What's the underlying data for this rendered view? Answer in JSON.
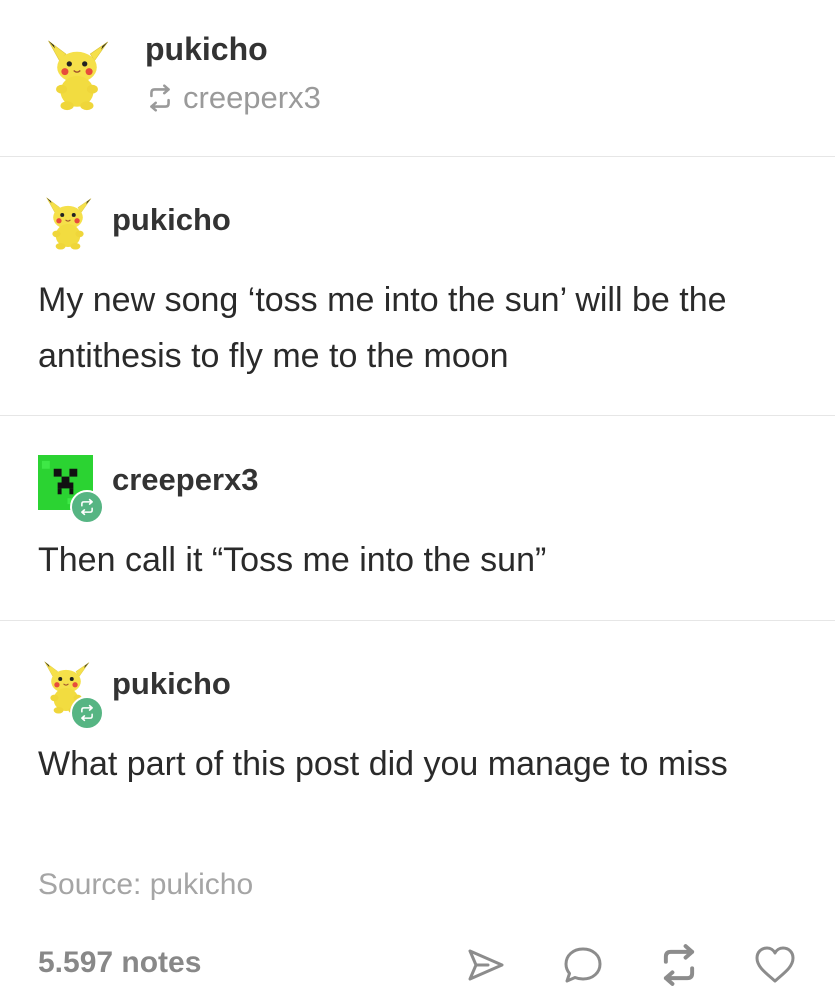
{
  "header": {
    "username": "pukicho",
    "reblogged_from": "creeperx3",
    "avatar_icon": "pikachu-plush-avatar",
    "reblog_icon": "reblog-icon"
  },
  "posts": [
    {
      "username": "pukicho",
      "avatar_icon": "pikachu-plush-avatar",
      "reblogged": false,
      "text": "My new song ‘toss me into the sun’ will be the antithesis to fly me to the moon"
    },
    {
      "username": "creeperx3",
      "avatar_icon": "creeper-face-avatar",
      "reblogged": true,
      "text": "Then call it “Toss me into the sun”"
    },
    {
      "username": "pukicho",
      "avatar_icon": "pikachu-plush-avatar",
      "reblogged": true,
      "text": "What part of this post did you manage to miss"
    }
  ],
  "footer": {
    "source_label": "Source: pukicho",
    "notes": "5.597 notes",
    "actions": [
      "share-icon",
      "reply-icon",
      "reblog-icon",
      "like-icon"
    ]
  },
  "colors": {
    "text": "#2a2a2a",
    "muted": "#9a9a9a",
    "divider": "#e6e6e6",
    "reblog_badge": "#56b583",
    "pikachu_yellow": "#f5e04a",
    "creeper_green": "#2bd332"
  }
}
